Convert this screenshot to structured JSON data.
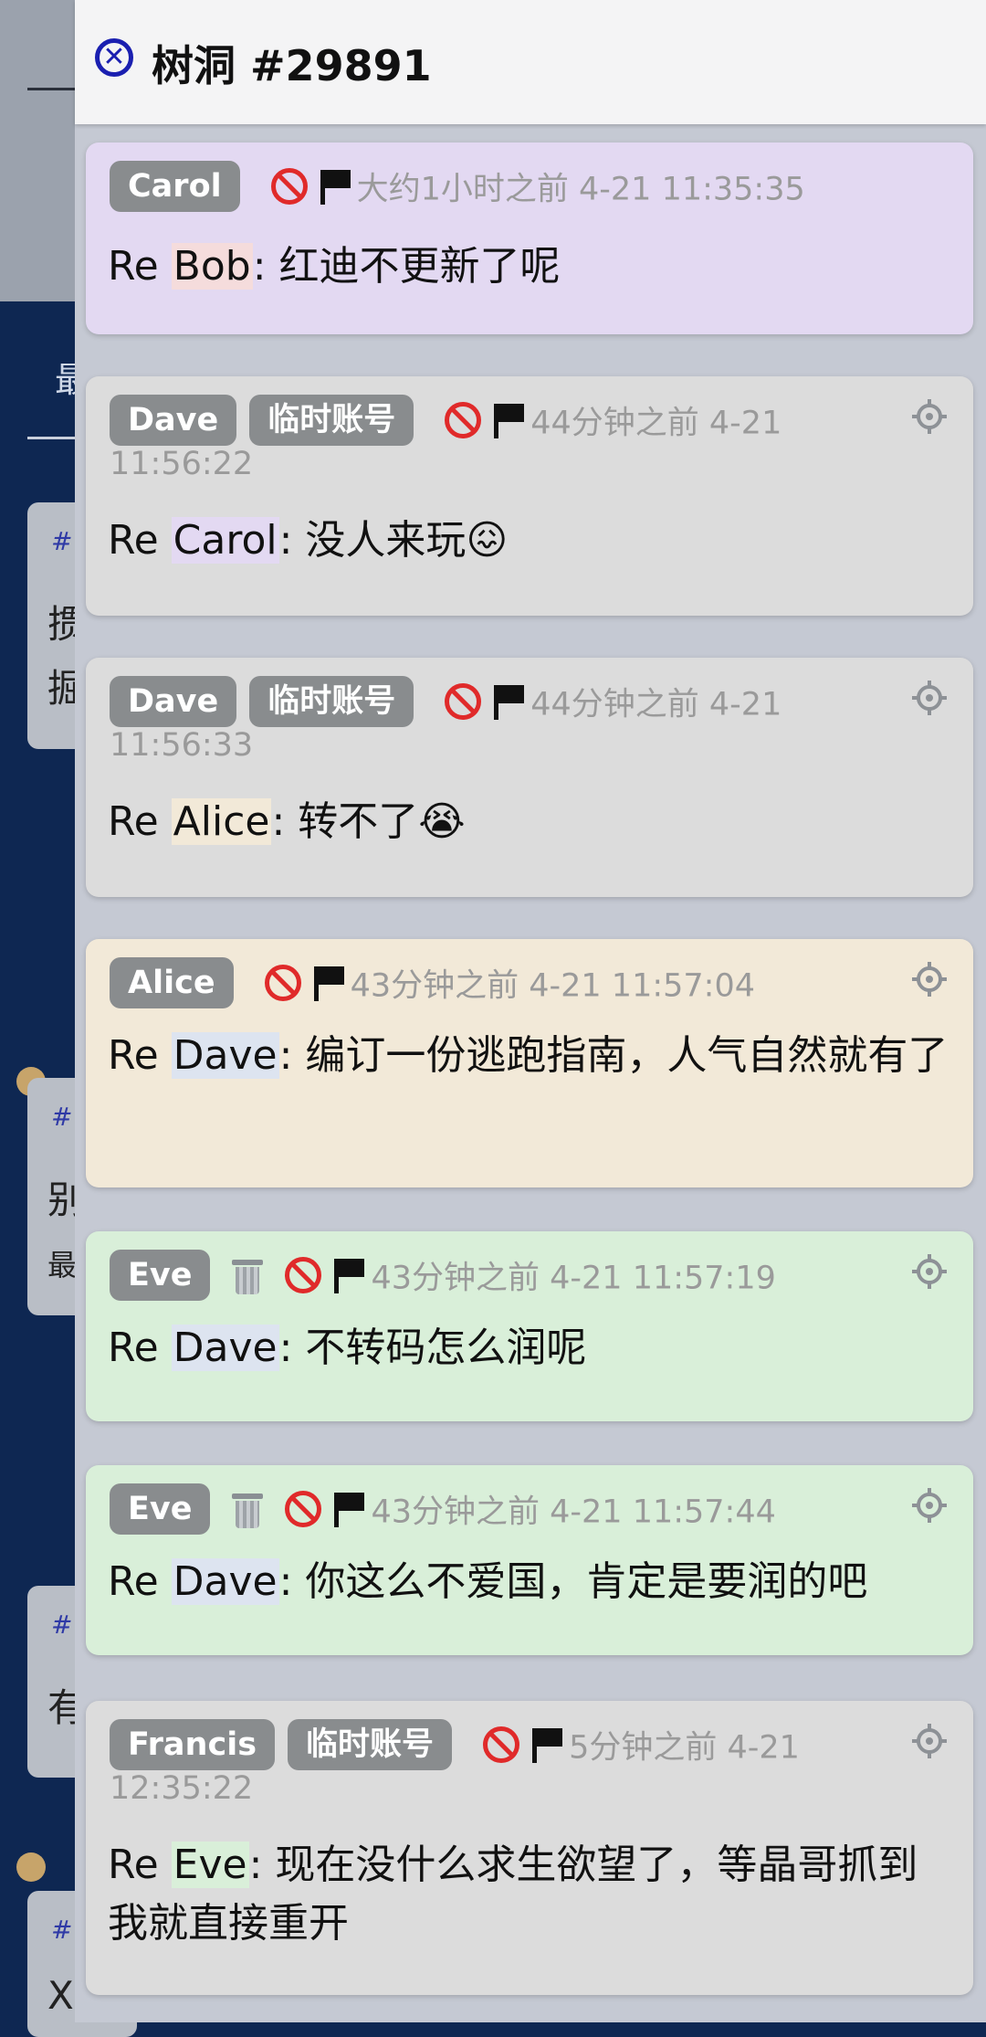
{
  "header": {
    "title": "树洞 #29891"
  },
  "background": {
    "tab_fragment": "最",
    "card1_lines": [
      "#",
      "掼",
      "掘"
    ],
    "card2_lines": [
      "#",
      "别",
      "最"
    ],
    "card3_lines": [
      "#",
      "有"
    ],
    "card4_lines": [
      "#",
      "X"
    ]
  },
  "replies": [
    {
      "name": "Carol",
      "temp_badge": "",
      "time": "大约1小时之前 4-21 11:35:35",
      "time_cont": "",
      "re_name": "Bob",
      "text": ": 红迪不更新了呢",
      "bg": "#e3d9f2",
      "re_bg": "#f5dcdc"
    },
    {
      "name": "Dave",
      "temp_badge": "临时账号",
      "time": "44分钟之前 4-21",
      "time_cont": "11:56:22",
      "re_name": "Carol",
      "text": ": 没人来玩😖",
      "bg": "#dcdcdc",
      "re_bg": "#e3d9f2"
    },
    {
      "name": "Dave",
      "temp_badge": "临时账号",
      "time": "44分钟之前 4-21",
      "time_cont": "11:56:33",
      "re_name": "Alice",
      "text": ": 转不了😭",
      "bg": "#dcdcdc",
      "re_bg": "#f2e9d8"
    },
    {
      "name": "Alice",
      "temp_badge": "",
      "time": "43分钟之前 4-21 11:57:04",
      "time_cont": "",
      "re_name": "Dave",
      "text": ": 编订一份逃跑指南，人气自然就有了",
      "bg": "#f2e9d8",
      "re_bg": "#dde4f0"
    },
    {
      "name": "Eve",
      "temp_badge": "",
      "time": "43分钟之前 4-21 11:57:19",
      "time_cont": "",
      "re_name": "Dave",
      "text": ": 不转码怎么润呢",
      "bg": "#d9efd9",
      "re_bg": "#dde4f0"
    },
    {
      "name": "Eve",
      "temp_badge": "",
      "time": "43分钟之前 4-21 11:57:44",
      "time_cont": "",
      "re_name": "Dave",
      "text": ": 你这么不爱国，肯定是要润的吧",
      "bg": "#d9efd9",
      "re_bg": "#dde4f0"
    },
    {
      "name": "Francis",
      "temp_badge": "临时账号",
      "time": "5分钟之前 4-21",
      "time_cont": "12:35:22",
      "re_name": "Eve",
      "text": ": 现在没什么求生欲望了，等晶哥抓到我就直接重开",
      "bg": "#dcdcdc",
      "re_bg": "#d9efd9"
    }
  ],
  "re_prefix": "Re "
}
